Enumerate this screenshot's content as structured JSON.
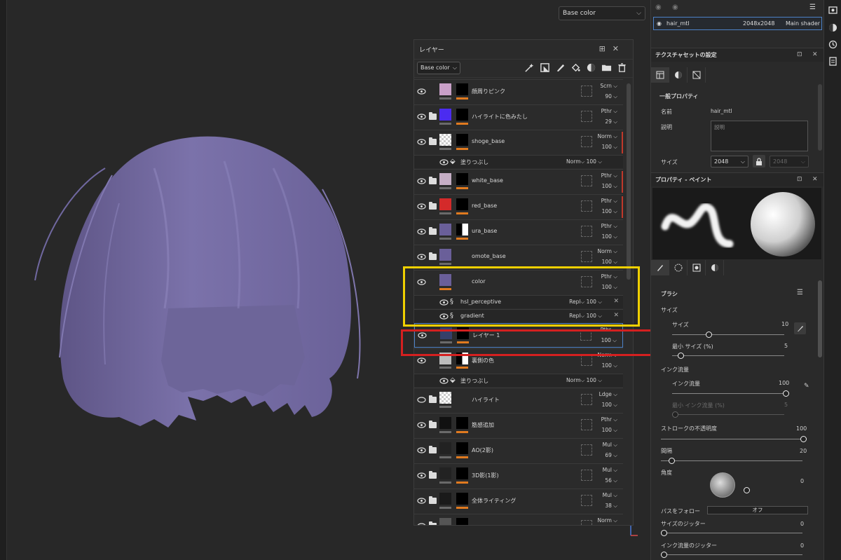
{
  "viewport": {
    "channel_select": "Base color"
  },
  "layers": {
    "title": "レイヤー",
    "channel_select": "Base color",
    "rows": [
      {
        "name": "顔周りピンク",
        "blend": "Scrn",
        "opacity": "90",
        "thumb_color": "#c9a0c8",
        "kind": "layer",
        "visible": true
      },
      {
        "name": "ハイライトに色みたし",
        "blend": "Pthr",
        "opacity": "29",
        "thumb_color": "#4b2cf0",
        "kind": "folder",
        "visible": true
      },
      {
        "name": "shoge_base",
        "blend": "Norm",
        "opacity": "100",
        "thumb_color": "checker",
        "kind": "folder",
        "visible": true
      },
      {
        "name": "塗りつぶし",
        "blend": "Norm",
        "opacity": "100",
        "kind": "fill",
        "visible": true
      },
      {
        "name": "white_base",
        "blend": "Pthr",
        "opacity": "100",
        "thumb_color": "#c5aec5",
        "kind": "folder",
        "visible": true
      },
      {
        "name": "red_base",
        "blend": "Pthr",
        "opacity": "100",
        "thumb_color": "#d42a2a",
        "kind": "folder",
        "visible": true
      },
      {
        "name": "ura_base",
        "blend": "Pthr",
        "opacity": "100",
        "thumb_color": "#6a5f99",
        "kind": "folder",
        "visible": true
      },
      {
        "name": "omote_base",
        "blend": "Norm",
        "opacity": "100",
        "thumb_color": "#6a5f99",
        "kind": "openfolder",
        "visible": true
      },
      {
        "name": "color",
        "blend": "Pthr",
        "opacity": "100",
        "thumb_color": "#6a5f99",
        "kind": "layer",
        "visible": true
      },
      {
        "name": "hsl_perceptive",
        "blend": "Repl",
        "opacity": "100",
        "kind": "filter",
        "visible": true
      },
      {
        "name": "gradient",
        "blend": "Repl",
        "opacity": "100",
        "kind": "filter",
        "visible": true
      },
      {
        "name": "レイヤー 1",
        "blend": "Pthr",
        "opacity": "100",
        "thumb_color": "#35406a",
        "kind": "layer",
        "visible": true
      },
      {
        "name": "裏側の色",
        "blend": "Norm",
        "opacity": "100",
        "thumb_color": "#bdbdbd",
        "kind": "layer",
        "visible": true
      },
      {
        "name": "塗りつぶし",
        "blend": "Norm",
        "opacity": "100",
        "kind": "fill",
        "visible": true
      },
      {
        "name": "ハイライト",
        "blend": "Ldge",
        "opacity": "100",
        "thumb_color": "checker",
        "kind": "folder",
        "visible": false
      },
      {
        "name": "筋感追加",
        "blend": "Pthr",
        "opacity": "100",
        "thumb_color": "#111111",
        "kind": "folder",
        "visible": true
      },
      {
        "name": "AO(2影)",
        "blend": "Mul",
        "opacity": "69",
        "thumb_color": "#222222",
        "kind": "folder",
        "visible": true
      },
      {
        "name": "3D影(1影)",
        "blend": "Mul",
        "opacity": "56",
        "thumb_color": "#222222",
        "kind": "folder",
        "visible": true
      },
      {
        "name": "全体ライティング",
        "blend": "Mul",
        "opacity": "38",
        "thumb_color": "#1a1a1a",
        "kind": "folder",
        "visible": true
      },
      {
        "name": "",
        "blend": "Norm",
        "opacity": "",
        "thumb_color": "#555555",
        "kind": "folder",
        "visible": true
      }
    ]
  },
  "textureset": {
    "name": "hair_mtl",
    "size": "2048x2048",
    "shader": "Main shader"
  },
  "textureset_settings": {
    "title": "テクスチャセットの設定",
    "section": "一般プロパティ",
    "name_label": "名前",
    "name_value": "hair_mtl",
    "desc_label": "説明",
    "desc_placeholder": "説明",
    "size_label": "サイズ",
    "size_value": "2048",
    "size_value2": "2048"
  },
  "paint_props": {
    "title": "プロパティ - ペイント",
    "brush_section": "ブラシ",
    "size_group": "サイズ",
    "size_label": "サイズ",
    "size_value": "10",
    "min_size_label": "最小 サイズ (%)",
    "min_size_value": "5",
    "flow_group": "インク流量",
    "flow_label": "インク流量",
    "flow_value": "100",
    "min_flow_label": "最小 インク流量 (%)",
    "min_flow_value": "5",
    "stroke_opacity_label": "ストロークの不透明度",
    "stroke_opacity_value": "100",
    "spacing_label": "間隔",
    "spacing_value": "20",
    "angle_label": "角度",
    "angle_value": "0",
    "follow_path_label": "パスをフォロー",
    "follow_path_value": "オフ",
    "size_jitter_label": "サイズのジッター",
    "size_jitter_value": "0",
    "flow_jitter_label": "インク流量のジッター",
    "flow_jitter_value": "0"
  }
}
